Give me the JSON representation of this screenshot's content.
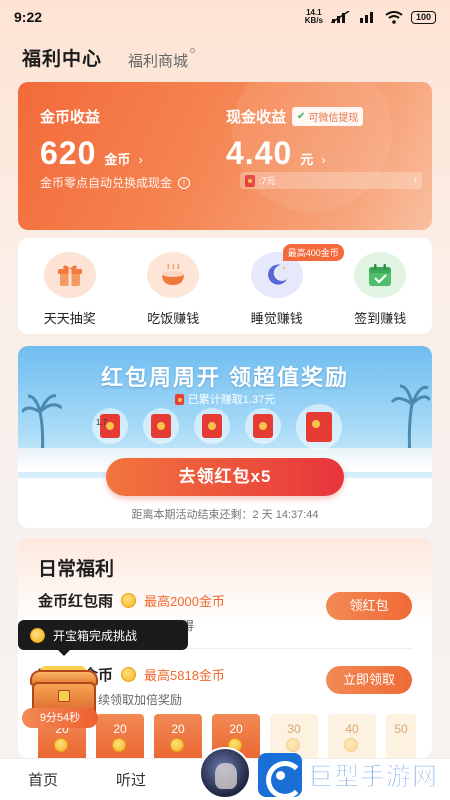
{
  "status_bar": {
    "time": "9:22",
    "speed_value": "14.1",
    "speed_unit": "KB/s",
    "battery": "100"
  },
  "header": {
    "title": "福利中心",
    "subtab": "福利商城"
  },
  "earnings": {
    "coin_label": "金币收益",
    "coin_value": "620",
    "coin_unit": "金币",
    "cash_label": "现金收益",
    "cash_badge": "可微信提现",
    "cash_value": "4.40",
    "cash_unit": "元",
    "auto_convert_note": "金币零点自动兑换成现金",
    "cash_pill_text": ":7元"
  },
  "quick_actions": [
    {
      "label": "天天抽奖",
      "icon": "gift-icon"
    },
    {
      "label": "吃饭赚钱",
      "icon": "rice-bowl-icon"
    },
    {
      "label": "睡觉赚钱",
      "icon": "moon-icon",
      "badge": "最高400金币"
    },
    {
      "label": "签到赚钱",
      "icon": "calendar-check-icon"
    }
  ],
  "promo": {
    "title": "红包周周开 领超值奖励",
    "earned_text": "已累计赚取1.37元",
    "first_pack_label": "1.7",
    "button_label": "去领红包x5",
    "countdown": "距离本期活动结束还剩：2 天 14:37:44"
  },
  "daily": {
    "title": "日常福利",
    "tasks": [
      {
        "name": "金币红包雨",
        "reward": "最高2000金币",
        "desc": "奏，先到先得",
        "button": "领红包"
      },
      {
        "name": "听书赚金币",
        "reward": "最高5818金币",
        "desc": "续领取加倍奖励",
        "button": "立即领取"
      }
    ]
  },
  "treasure": {
    "tooltip": "开宝箱完成挑战",
    "timer": "9分54秒"
  },
  "coin_strip": [
    "20",
    "20",
    "20",
    "20",
    "30",
    "40",
    "50"
  ],
  "bottom_nav": {
    "home": "首页",
    "listened": "听过"
  },
  "watermark": {
    "text": "巨型手游网"
  },
  "colors": {
    "accent_orange": "#f36a3a",
    "button_red": "#e8353c",
    "reward_orange": "#f06a2e"
  }
}
